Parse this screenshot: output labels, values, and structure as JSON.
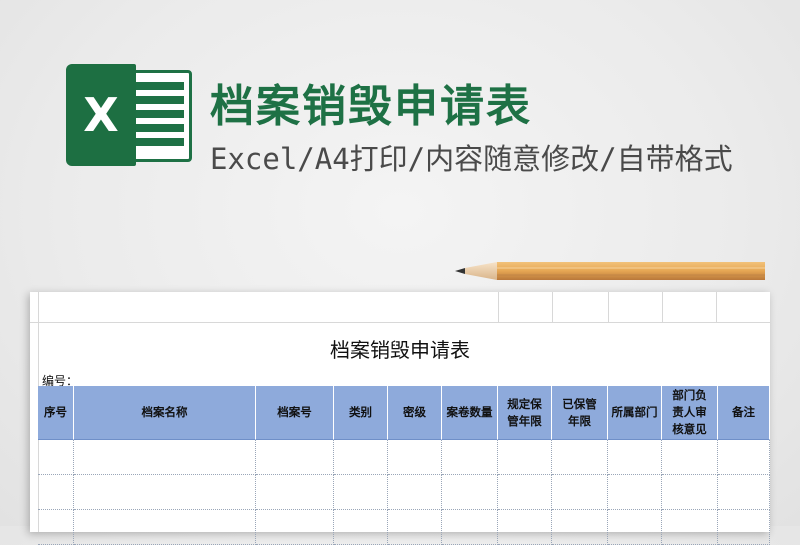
{
  "banner": {
    "logo_letter": "X",
    "title": "档案销毁申请表",
    "subtitle": "Excel/A4打印/内容随意修改/自带格式",
    "brand_color": "#1e7145"
  },
  "sheet": {
    "title": "档案销毁申请表",
    "number_label": "编号：",
    "header_fill": "#8eaadb",
    "columns": [
      {
        "label": "序号"
      },
      {
        "label": "档案名称"
      },
      {
        "label": "档案号"
      },
      {
        "label": "类别"
      },
      {
        "label": "密级"
      },
      {
        "label": "案卷数量"
      },
      {
        "label": "规定保管年限"
      },
      {
        "label": "已保管年限"
      },
      {
        "label": "所属部门"
      },
      {
        "label": "部门负责人审核意见"
      },
      {
        "label": "备注"
      }
    ]
  }
}
